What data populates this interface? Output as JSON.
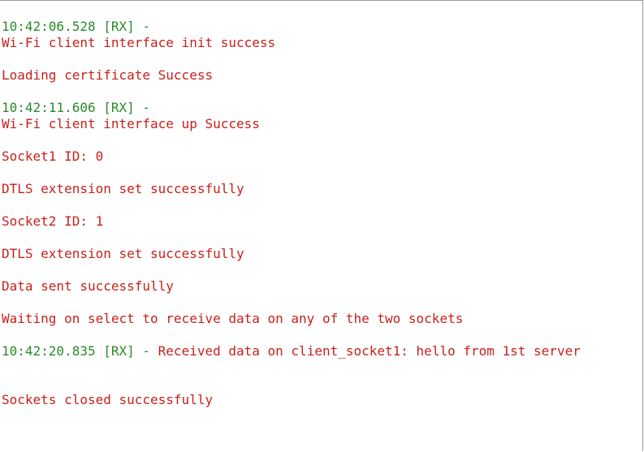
{
  "colors": {
    "timestamp": "#2a8a2a",
    "message": "#c8201c",
    "background": "#ffffff"
  },
  "log": [
    {
      "ts": "10:42:06.528 [RX] -",
      "msg": ""
    },
    {
      "ts": "",
      "msg": "Wi-Fi client interface init success"
    },
    {
      "ts": "",
      "msg": "Loading certificate Success"
    },
    {
      "ts": "10:42:11.606 [RX] -",
      "msg": ""
    },
    {
      "ts": "",
      "msg": "Wi-Fi client interface up Success"
    },
    {
      "ts": "",
      "msg": "Socket1 ID: 0"
    },
    {
      "ts": "",
      "msg": "DTLS extension set successfully"
    },
    {
      "ts": "",
      "msg": "Socket2 ID: 1"
    },
    {
      "ts": "",
      "msg": "DTLS extension set successfully"
    },
    {
      "ts": "",
      "msg": "Data sent successfully"
    },
    {
      "ts": "",
      "msg": "Waiting on select to receive data on any of the two sockets"
    },
    {
      "ts": "10:42:20.835 [RX] -",
      "msg": " Received data on client_socket1: hello from 1st server"
    },
    {
      "ts": "",
      "msg": "Sockets closed successfully"
    }
  ]
}
